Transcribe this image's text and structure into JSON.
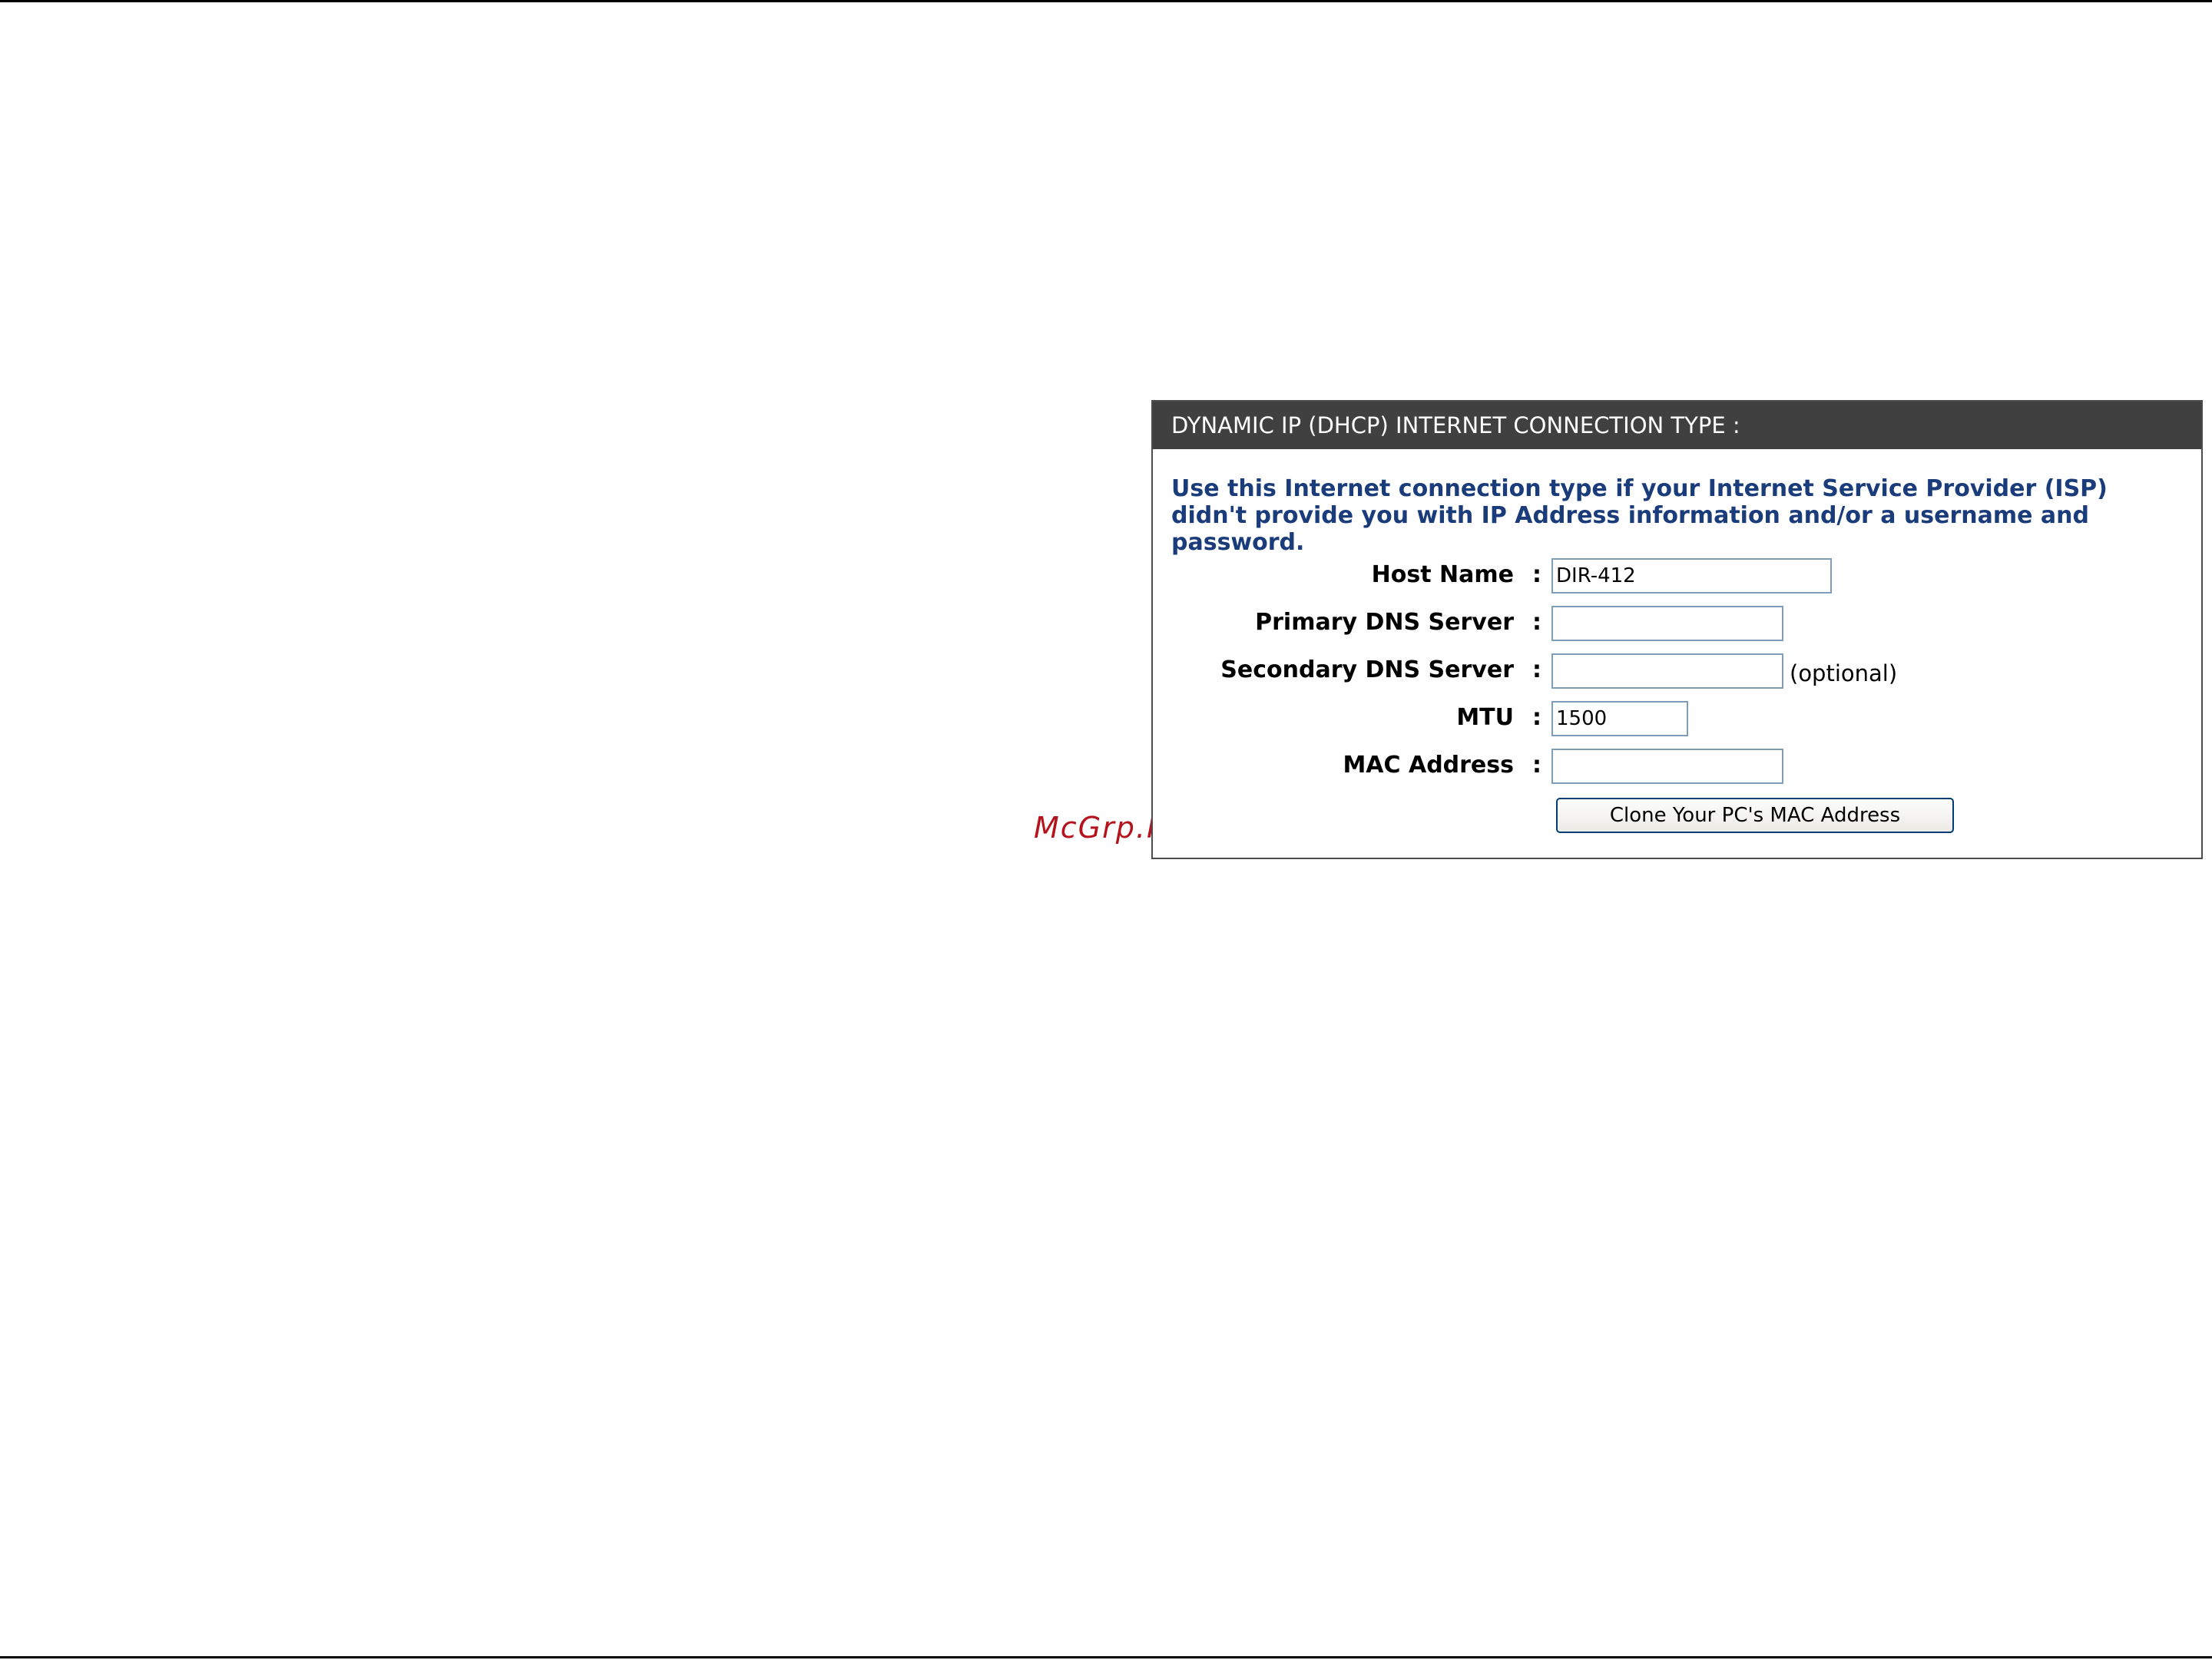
{
  "watermark": "McGrp.Ru",
  "panel": {
    "header": "DYNAMIC IP (DHCP) INTERNET CONNECTION TYPE :",
    "description": "Use this Internet connection type if your Internet Service Provider (ISP) didn't provide you with IP Address information and/or a username and password.",
    "fields": {
      "host_name": {
        "label": "Host Name",
        "value": "DIR-412"
      },
      "primary_dns": {
        "label": "Primary DNS Server",
        "value": ""
      },
      "secondary_dns": {
        "label": "Secondary DNS Server",
        "value": "",
        "note": "(optional)"
      },
      "mtu": {
        "label": "MTU",
        "value": "1500"
      },
      "mac_address": {
        "label": "MAC Address",
        "value": ""
      }
    },
    "colon": ":",
    "clone_button": "Clone Your PC's MAC Address"
  }
}
